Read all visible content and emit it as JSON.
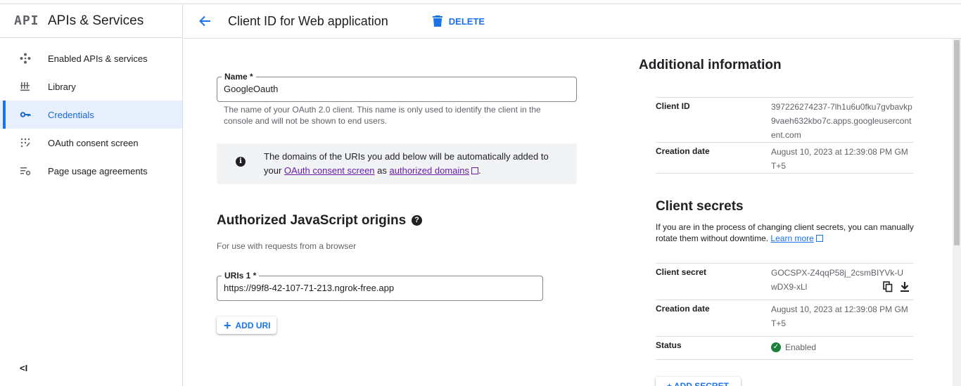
{
  "sidebar": {
    "logo": "API",
    "title": "APIs & Services",
    "items": [
      {
        "label": "Enabled APIs & services",
        "icon": "diamond-dots-icon"
      },
      {
        "label": "Library",
        "icon": "library-icon"
      },
      {
        "label": "Credentials",
        "icon": "key-icon",
        "active": true
      },
      {
        "label": "OAuth consent screen",
        "icon": "dot-grid-icon"
      },
      {
        "label": "Page usage agreements",
        "icon": "settings-list-icon"
      }
    ],
    "collapse_label": "<I"
  },
  "header": {
    "title": "Client ID for Web application",
    "delete_label": "DELETE"
  },
  "form": {
    "name_label": "Name *",
    "name_value": "GoogleOauth",
    "name_hint": "The name of your OAuth 2.0 client. This name is only used to identify the client in the console and will not be shown to end users.",
    "info_text_before": "The domains of the URIs you add below will be automatically added to your ",
    "info_link_consent": "OAuth consent screen",
    "info_text_as": " as ",
    "info_link_domains": "authorized domains",
    "info_text_end": ".",
    "origins_title": "Authorized JavaScript origins",
    "origins_hint": "For use with requests from a browser",
    "uri_label": "URIs 1 *",
    "uri_value": "https://99f8-42-107-71-213.ngrok-free.app",
    "add_uri_label": "ADD URI"
  },
  "additional": {
    "title": "Additional information",
    "client_id_label": "Client ID",
    "client_id_value": "397226274237-7lh1u6u0fku7gvbavkp9vaeh632kbo7c.apps.googleusercontent.com",
    "creation_label": "Creation date",
    "creation_value": "August 10, 2023 at 12:39:08 PM GMT+5"
  },
  "secrets": {
    "title": "Client secrets",
    "description": "If you are in the process of changing client secrets, you can manually rotate them without downtime.",
    "learn_more": "Learn more",
    "secret_label": "Client secret",
    "secret_value": "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",
    "creation_label": "Creation date",
    "creation_value": "August 10, 2023 at 12:39:08 PM GMT+5",
    "status_label": "Status",
    "status_value": "Enabled",
    "add_secret_label": "+ ADD SECRET"
  },
  "colors": {
    "accent": "#1a73e8",
    "active_bg": "#e8f0fe",
    "visited_link": "#681da8",
    "success": "#188038"
  }
}
